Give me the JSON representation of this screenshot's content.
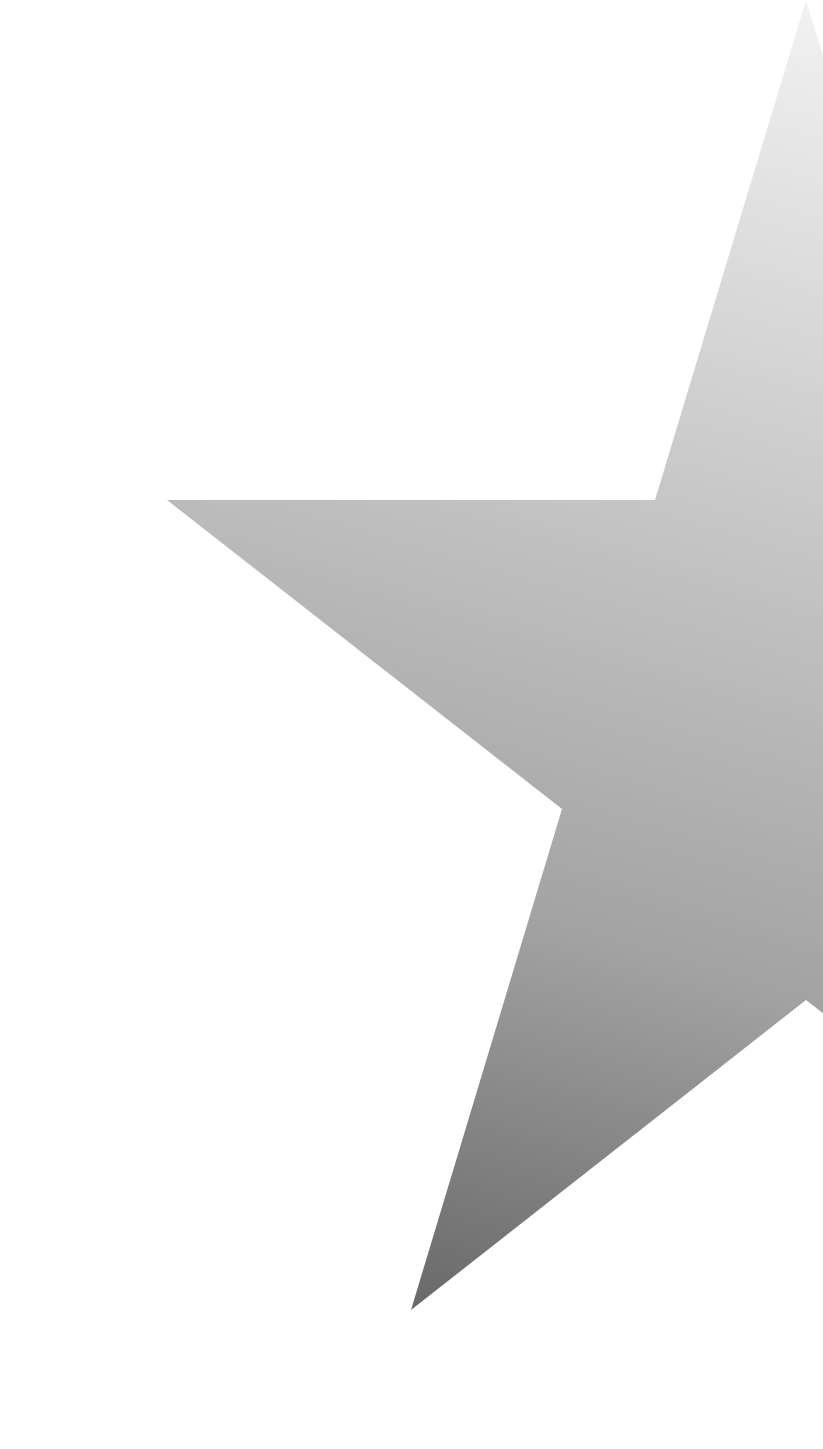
{
  "background_color": "#ffffff",
  "star": {
    "icon": "star-icon",
    "gradient_colors": [
      "#f2f2f2",
      "#c4c4c4",
      "#a3a3a3",
      "#696969"
    ]
  }
}
